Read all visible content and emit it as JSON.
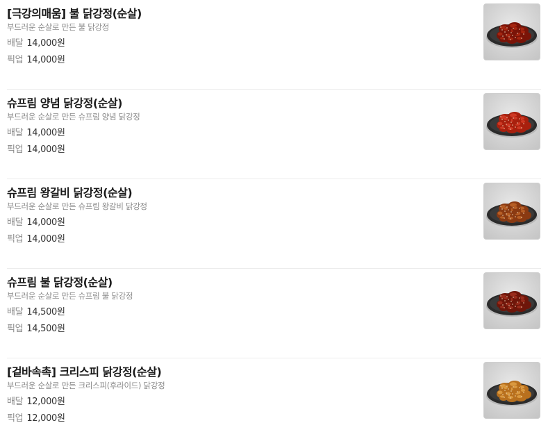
{
  "price_labels": {
    "delivery": "배달",
    "pickup": "픽업"
  },
  "items": [
    {
      "name": "[극강의매움] 불 닭강정(순살)",
      "description": "부드러운 순살로 만든 불 닭강정",
      "delivery_price": "14,000원",
      "pickup_price": "14,000원",
      "image": "spicy-fire-chicken-plate",
      "sauce_color": "#7a1408",
      "highlight_color": "#b02a14"
    },
    {
      "name": "슈프림 양념 닭강정(순살)",
      "description": "부드러운 순살로 만든 슈프림 양념 닭강정",
      "delivery_price": "14,000원",
      "pickup_price": "14,000원",
      "image": "seasoned-chicken-plate",
      "sauce_color": "#a8200e",
      "highlight_color": "#d8402a"
    },
    {
      "name": "슈프림 왕갈비 닭강정(순살)",
      "description": "부드러운 순살로 만든 슈프림 왕갈비 닭강정",
      "delivery_price": "14,000원",
      "pickup_price": "14,000원",
      "image": "galbi-chicken-plate",
      "sauce_color": "#8a3a12",
      "highlight_color": "#c2692c"
    },
    {
      "name": "슈프림 불 닭강정(순살)",
      "description": "부드러운 순살로 만든 슈프림 불 닭강정",
      "delivery_price": "14,500원",
      "pickup_price": "14,500원",
      "image": "supreme-fire-chicken-plate",
      "sauce_color": "#6e160a",
      "highlight_color": "#a43220"
    },
    {
      "name": "[겉바속촉] 크리스피 닭강정(순살)",
      "description": "부드러운 순살로 만든 크리스피(후라이드) 닭강정",
      "delivery_price": "12,000원",
      "pickup_price": "12,000원",
      "image": "crispy-chicken-plate",
      "sauce_color": "#b8701e",
      "highlight_color": "#e2a448"
    }
  ]
}
